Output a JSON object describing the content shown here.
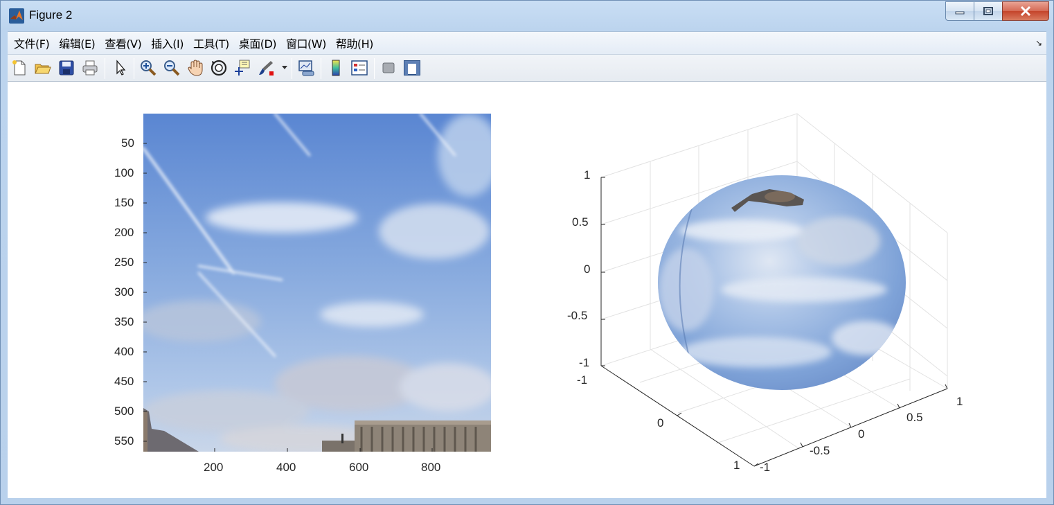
{
  "window": {
    "title": "Figure 2"
  },
  "menu": {
    "items": [
      "文件(F)",
      "编辑(E)",
      "查看(V)",
      "插入(I)",
      "工具(T)",
      "桌面(D)",
      "窗口(W)",
      "帮助(H)"
    ]
  },
  "toolbar": {
    "icons": [
      "new-figure-icon",
      "open-file-icon",
      "save-icon",
      "print-icon",
      "pointer-icon",
      "zoom-in-icon",
      "zoom-out-icon",
      "pan-hand-icon",
      "rotate-3d-icon",
      "data-cursor-icon",
      "brush-icon",
      "link-plot-icon",
      "colorbar-icon",
      "legend-icon",
      "hide-plot-tools-icon",
      "show-plot-tools-icon"
    ]
  },
  "plot_left": {
    "y_ticks": [
      "50",
      "100",
      "150",
      "200",
      "250",
      "300",
      "350",
      "400",
      "450",
      "500",
      "550"
    ],
    "x_ticks": [
      "200",
      "400",
      "600",
      "800"
    ]
  },
  "plot_right": {
    "z_ticks": [
      "1",
      "0.5",
      "0",
      "-0.5",
      "-1"
    ],
    "y_ticks": [
      "-1",
      "0",
      "1"
    ],
    "x_ticks": [
      "-1",
      "-0.5",
      "0",
      "0.5",
      "1"
    ]
  },
  "colors": {
    "sky_top": "#5b86d3",
    "sky_bottom": "#b9cdea",
    "axis_line": "#262626",
    "grid": "#e0e0e0"
  }
}
